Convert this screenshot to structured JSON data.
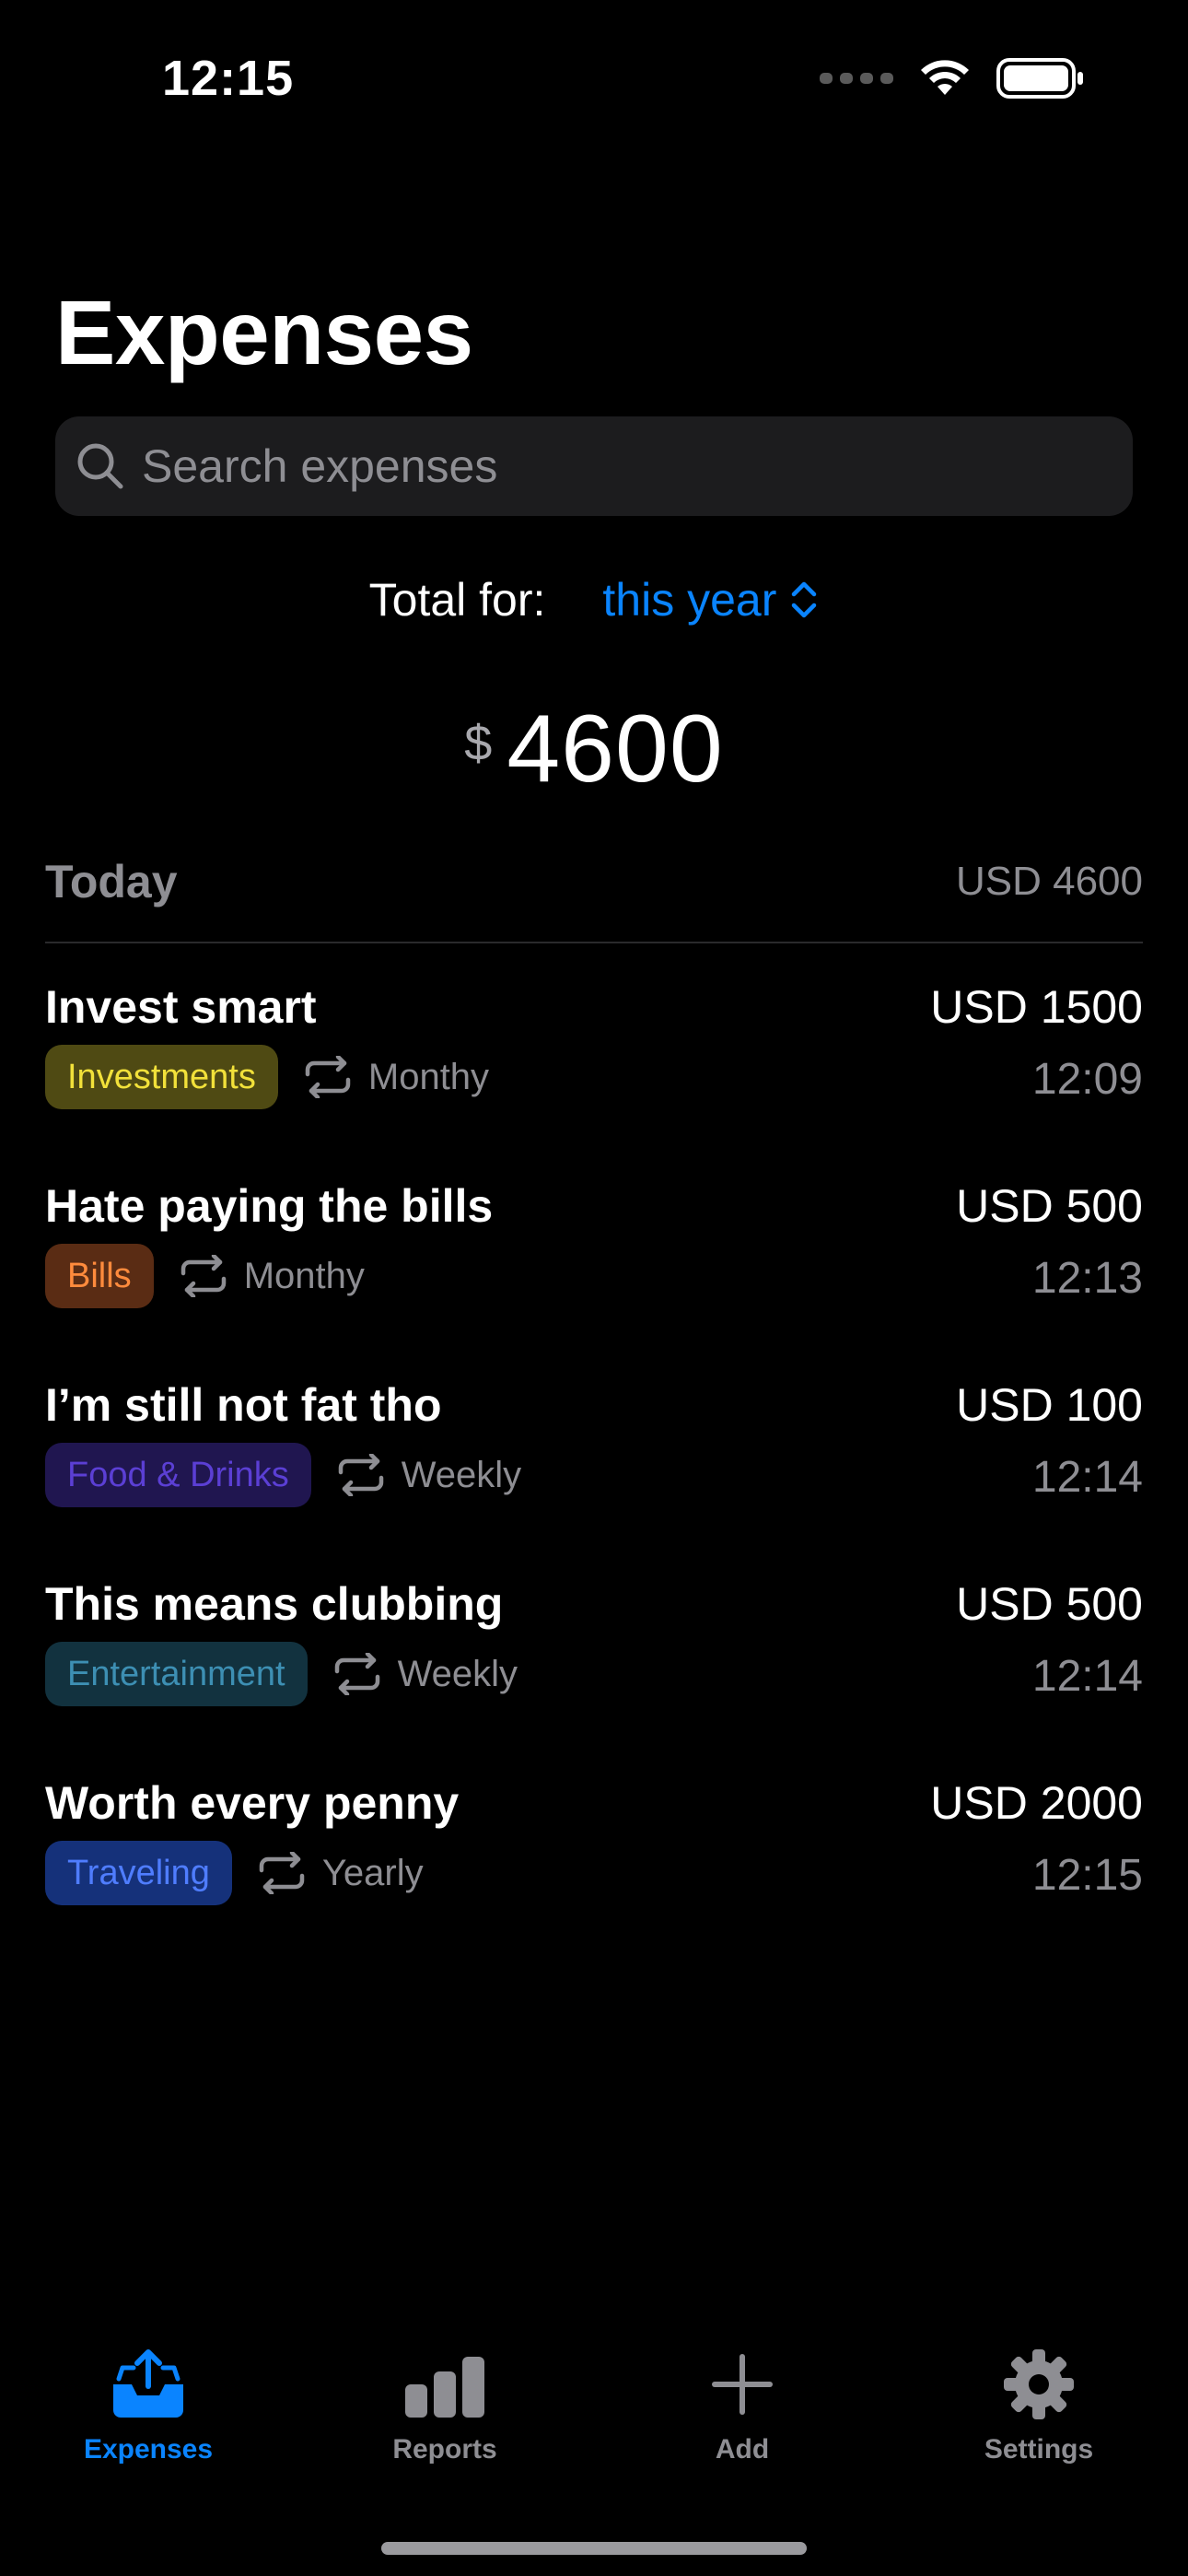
{
  "status_bar": {
    "time": "12:15"
  },
  "header": {
    "title": "Expenses"
  },
  "search": {
    "placeholder": "Search expenses",
    "value": ""
  },
  "summary": {
    "total_label": "Total for:",
    "period": "this year",
    "currency_symbol": "$",
    "amount": "4600"
  },
  "section": {
    "title": "Today",
    "total": "USD 4600"
  },
  "expenses": [
    {
      "title": "Invest smart",
      "category": "Investments",
      "category_color": "#f2e13a",
      "category_bg": "#4f4a13",
      "recurrence": "Monthy",
      "amount": "USD 1500",
      "time": "12:09"
    },
    {
      "title": "Hate paying the bills",
      "category": "Bills",
      "category_color": "#ff8b3d",
      "category_bg": "#5a2c14",
      "recurrence": "Monthy",
      "amount": "USD 500",
      "time": "12:13"
    },
    {
      "title": "I’m still not fat tho",
      "category": "Food & Drinks",
      "category_color": "#5b3fd4",
      "category_bg": "#201650",
      "recurrence": "Weekly",
      "amount": "USD 100",
      "time": "12:14"
    },
    {
      "title": "This means clubbing",
      "category": "Entertainment",
      "category_color": "#3d8fb3",
      "category_bg": "#12323f",
      "recurrence": "Weekly",
      "amount": "USD 500",
      "time": "12:14"
    },
    {
      "title": "Worth every penny",
      "category": "Traveling",
      "category_color": "#4f7dff",
      "category_bg": "#15317a",
      "recurrence": "Yearly",
      "amount": "USD 2000",
      "time": "12:15"
    }
  ],
  "tabs": [
    {
      "label": "Expenses",
      "icon": "tray-upload-icon",
      "active": true
    },
    {
      "label": "Reports",
      "icon": "bar-chart-icon",
      "active": false
    },
    {
      "label": "Add",
      "icon": "plus-icon",
      "active": false
    },
    {
      "label": "Settings",
      "icon": "gear-icon",
      "active": false
    }
  ],
  "colors": {
    "accent": "#0a84ff",
    "background": "#000000",
    "secondary_text": "#8e8e93"
  }
}
